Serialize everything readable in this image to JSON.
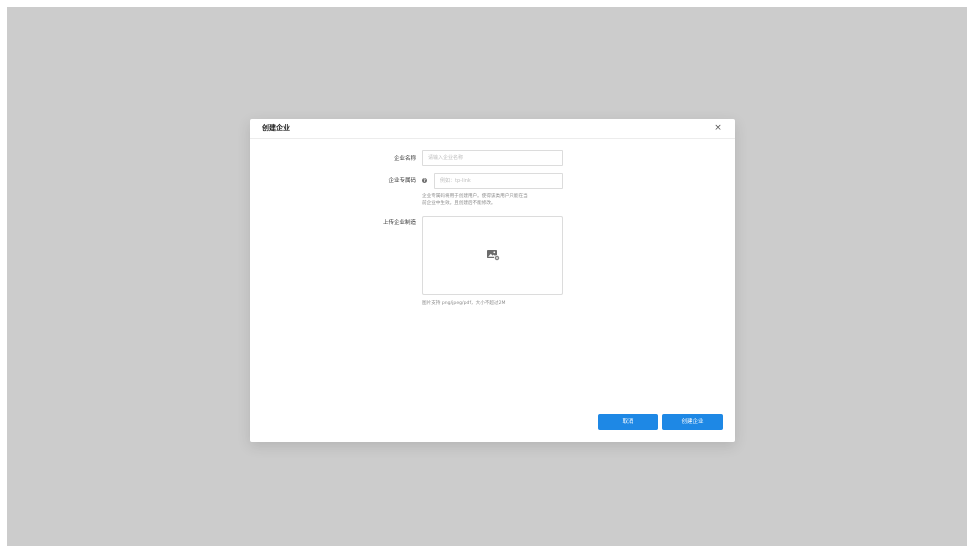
{
  "dialog": {
    "title": "创建企业",
    "close_label": "×"
  },
  "form": {
    "company_name": {
      "label": "企业名称",
      "placeholder": "请输入企业名称",
      "value": ""
    },
    "company_code": {
      "label": "企业专属码",
      "help_icon": "?",
      "placeholder": "例如：tp-link",
      "value": "",
      "hint_line1": "企业专属码将用于创建用户。使得该类用户只能在当",
      "hint_line2": "前企业中生效。且创建后不能修改。"
    },
    "company_logo": {
      "label": "上传企业制造",
      "icon": "image-upload-icon",
      "hint": "图片支持 png/jpeg/pdf，大小不超过2M"
    }
  },
  "actions": {
    "cancel_label": "取消",
    "create_label": "创建企业"
  },
  "colors": {
    "overlay": "#cccccc",
    "primary": "#1e88e5",
    "border": "#dcdcdc"
  }
}
